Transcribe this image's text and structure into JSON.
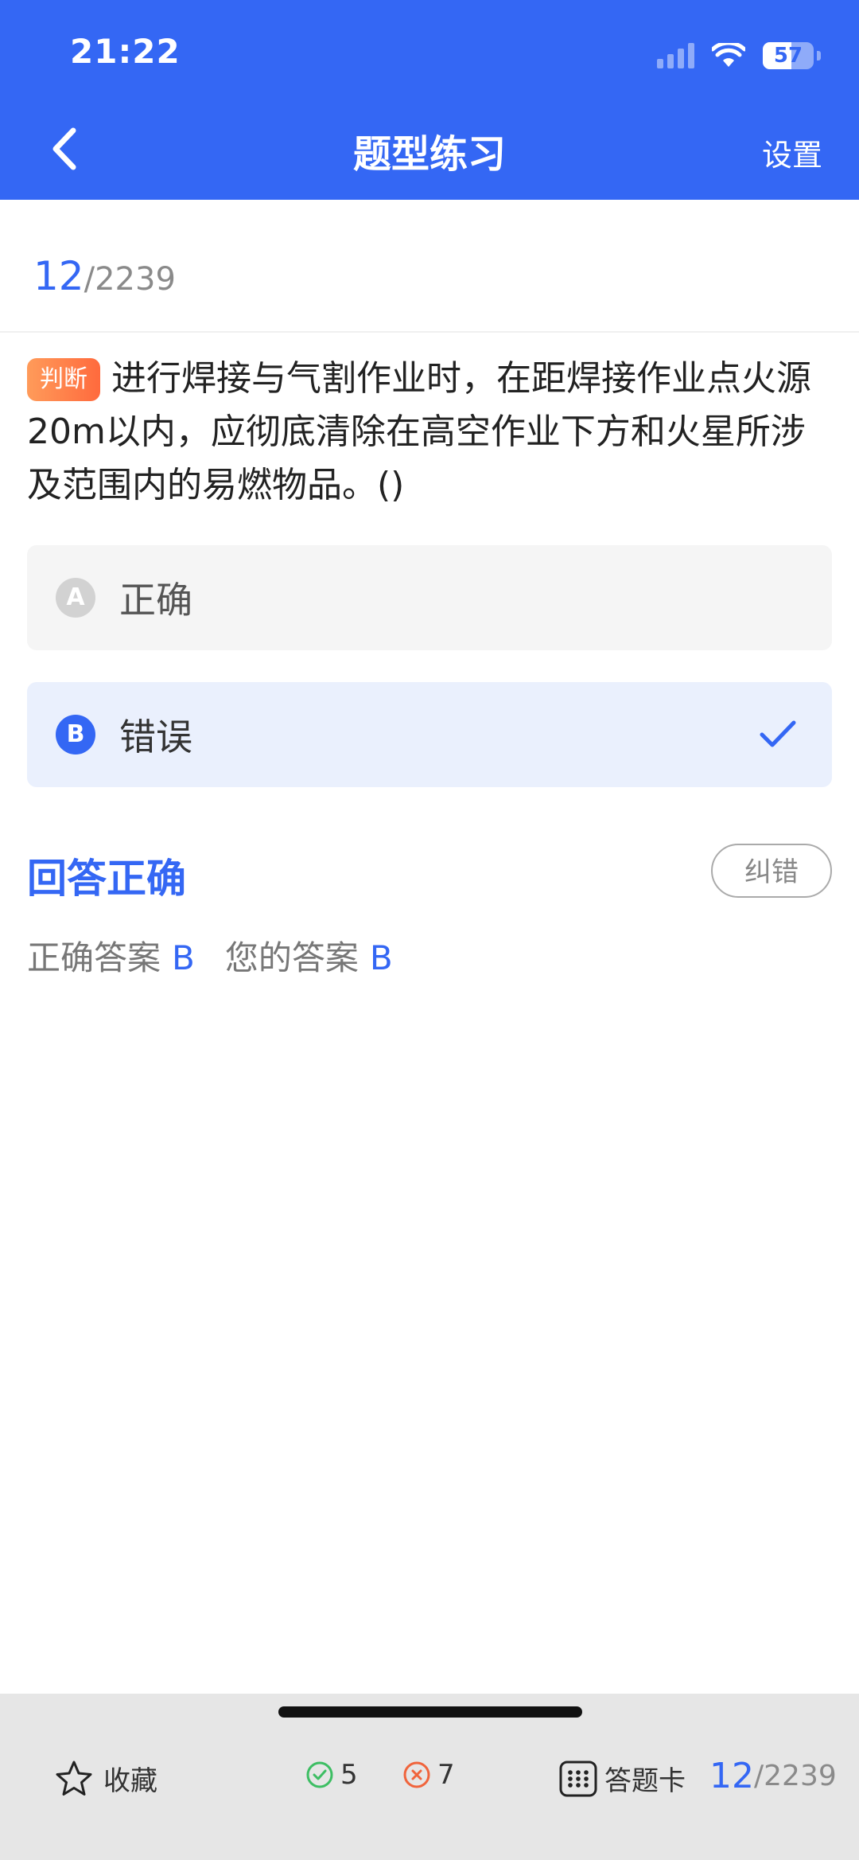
{
  "status_bar": {
    "time": "21:22",
    "battery": "57",
    "battery_level": 0.57,
    "icons": [
      "signal-icon",
      "wifi-icon",
      "battery-icon"
    ]
  },
  "nav": {
    "title": "题型练习",
    "settings_label": "设置",
    "back_icon": "chevron-left-icon"
  },
  "progress": {
    "current": "12",
    "total": "/2239"
  },
  "question": {
    "type_tag": "判断",
    "text": "进行焊接与气割作业时，在距焊接作业点火源20m以内，应彻底清除在高空作业下方和火星所涉及范围内的易燃物品。()"
  },
  "options": [
    {
      "letter": "A",
      "text": "正确",
      "selected": false
    },
    {
      "letter": "B",
      "text": "错误",
      "selected": true
    }
  ],
  "result": {
    "title": "回答正确",
    "report_label": "纠错",
    "correct_label": "正确答案",
    "correct_value": "B",
    "your_label": "您的答案",
    "your_value": "B"
  },
  "bottom_bar": {
    "favorite_label": "收藏",
    "right_count": "5",
    "wrong_count": "7",
    "answer_card_label": "答题卡",
    "current": "12",
    "total": "/2239"
  },
  "colors": {
    "primary": "#3467F4",
    "tag_orange": "#FF7A45",
    "correct_green": "#3DBE63",
    "wrong_red": "#F0643C"
  }
}
